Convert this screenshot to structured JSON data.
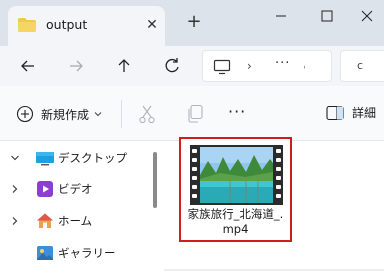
{
  "tab": {
    "title": "output",
    "close_glyph": "✕",
    "new_tab_glyph": "+"
  },
  "window_controls": [
    "minimize",
    "maximize",
    "close"
  ],
  "address_bar": {
    "chevron": "›",
    "ellipsis": "···",
    "dropdown_glyph": "ˌ"
  },
  "search": {
    "partial_text": "c"
  },
  "command_bar": {
    "new_label": "新規作成",
    "more_glyph": "···",
    "details_label": "詳細"
  },
  "nav_pane": {
    "items": [
      {
        "label": "デスクトップ",
        "expanded": true
      },
      {
        "label": "ビデオ",
        "expanded": false
      },
      {
        "label": "ホーム",
        "expanded": false
      },
      {
        "label": "ギャラリー",
        "expanded": false
      }
    ]
  },
  "files": [
    {
      "name": "家族旅行_北海道_.mp4",
      "selected": true
    }
  ],
  "colors": {
    "accent_highlight": "#d01c1c",
    "folder": "#f0c94a",
    "title_bar": "#dde3ea",
    "desktop_icon": "#1ba1e2",
    "video_icon": "#8a3fd1"
  }
}
